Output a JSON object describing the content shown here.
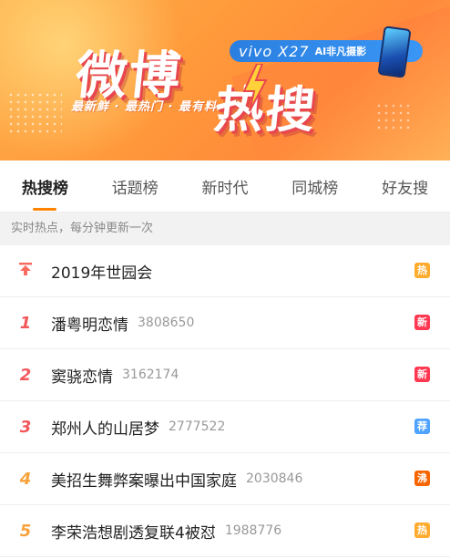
{
  "banner": {
    "title_1": "微博",
    "title_2": "热搜",
    "slogan": "最新鲜 · 最热门 · 最有料",
    "ad_brand": "vivo X27",
    "ad_tagline": "AI非凡摄影",
    "colors": {
      "bg": "#ff9a3b",
      "shadow": "#e8474e",
      "ad": "#2a7fe0"
    }
  },
  "tabs": [
    {
      "label": "热搜榜",
      "active": true
    },
    {
      "label": "话题榜",
      "active": false
    },
    {
      "label": "新时代",
      "active": false
    },
    {
      "label": "同城榜",
      "active": false
    },
    {
      "label": "好友搜",
      "active": false
    }
  ],
  "subheader": "实时热点，每分钟更新一次",
  "items": [
    {
      "rank": "",
      "rank_icon": "pin-top-icon",
      "title": "2019年世园会",
      "count": "",
      "badge": "热",
      "badge_type": "hot"
    },
    {
      "rank": "1",
      "title": "潘粤明恋情",
      "count": "3808650",
      "badge": "新",
      "badge_type": "new"
    },
    {
      "rank": "2",
      "title": "窦骁恋情",
      "count": "3162174",
      "badge": "新",
      "badge_type": "new"
    },
    {
      "rank": "3",
      "title": "郑州人的山居梦",
      "count": "2777522",
      "badge": "荐",
      "badge_type": "rec"
    },
    {
      "rank": "4",
      "title": "美招生舞弊案曝出中国家庭",
      "count": "2030846",
      "badge": "沸",
      "badge_type": "boil"
    },
    {
      "rank": "5",
      "title": "李荣浩想剧透复联4被怼",
      "count": "1988776",
      "badge": "热",
      "badge_type": "hot"
    }
  ]
}
